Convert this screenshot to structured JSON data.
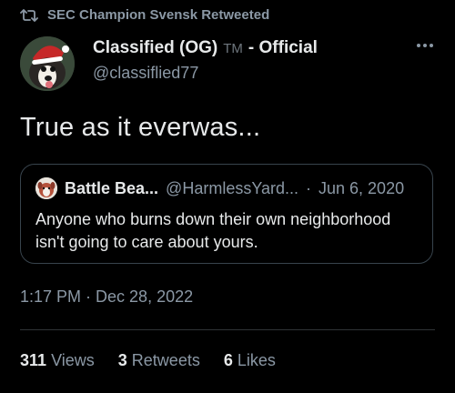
{
  "retweet": {
    "text": "SEC Champion Svensk Retweeted",
    "icon": "retweet-icon"
  },
  "author": {
    "display_name": "Classified (OG)",
    "tm": "TM",
    "suffix": "- Official",
    "handle": "@classiflied77",
    "avatar": "dog-santa-hat-avatar"
  },
  "tweet": {
    "text": "True as it everwas...",
    "timestamp": "1:17 PM · Dec 28, 2022"
  },
  "quote": {
    "name": "Battle Bea...",
    "handle": "@HarmlessYard...",
    "sep": "·",
    "date": "Jun 6, 2020",
    "text": "Anyone who burns down their own neighborhood isn't going to care about yours.",
    "avatar": "dog-avatar"
  },
  "stats": {
    "views_count": "311",
    "views_label": "Views",
    "retweets_count": "3",
    "retweets_label": "Retweets",
    "likes_count": "6",
    "likes_label": "Likes"
  },
  "colors": {
    "background": "#000000",
    "text": "#e7e9ea",
    "muted": "#8b98a5",
    "border": "#38444d"
  }
}
